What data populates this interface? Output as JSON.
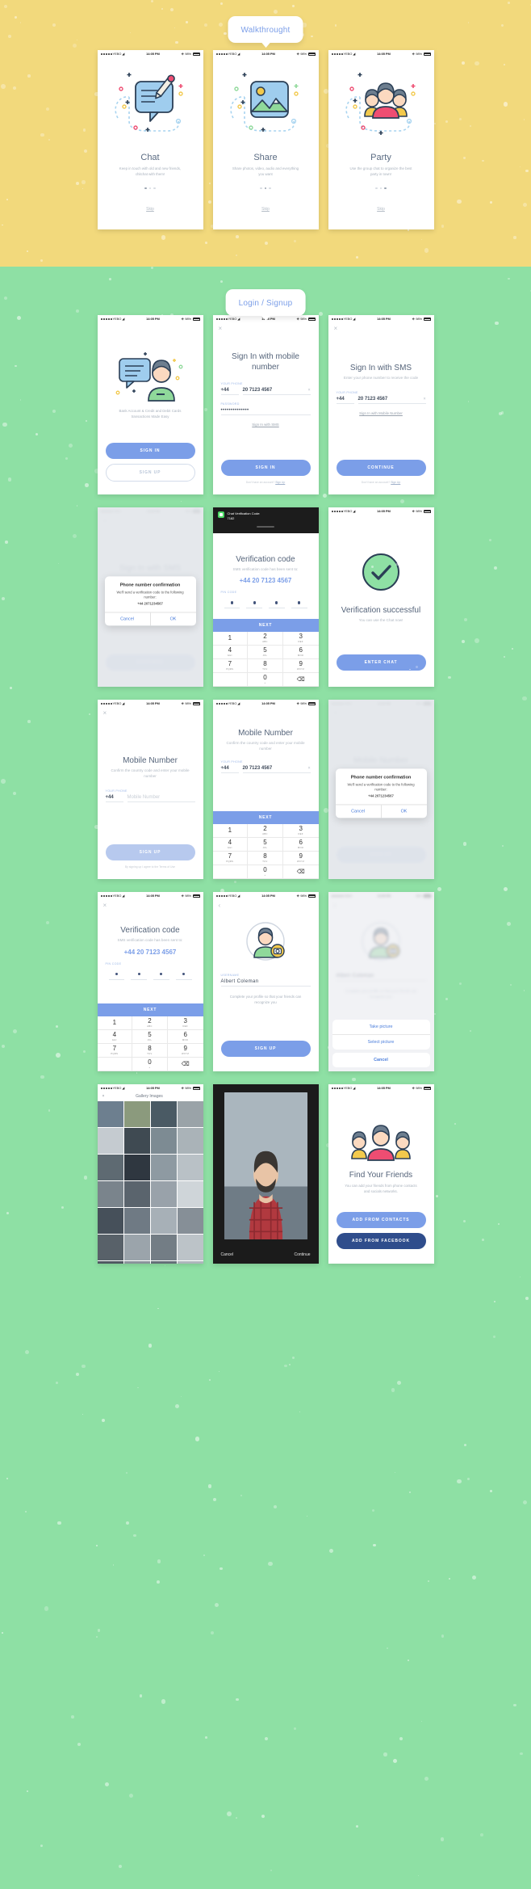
{
  "sections": [
    {
      "id": "walkthrough",
      "label": "Walkthrought",
      "bg": "#f2d97c"
    },
    {
      "id": "login_signup",
      "label": "Login / Signup",
      "bg": "#8ee0a4"
    }
  ],
  "status_bar": {
    "carrier": "YEBO",
    "time": "14:05 PM",
    "battery": "98%",
    "bluetooth_icon": "bluetooth-icon",
    "wifi_icon": "wifi-icon",
    "battery_icon": "battery-icon"
  },
  "walkthrough": {
    "slides": [
      {
        "title": "Chat",
        "subtitle": "Keep in touch with old and new friends, chitchat with them!",
        "skip": "Skip",
        "active_dot": 0,
        "icon": "chat-bubble-pencil-illustration"
      },
      {
        "title": "Share",
        "subtitle": "Share photos, video, audio and everything you want",
        "skip": "Skip",
        "active_dot": 1,
        "icon": "photo-landscape-illustration"
      },
      {
        "title": "Party",
        "subtitle": "Use the group chat to organize the best party in town!",
        "skip": "Skip",
        "active_dot": 2,
        "icon": "group-people-illustration"
      }
    ]
  },
  "screens": {
    "welcome": {
      "tagline": "Bank Account & Credit and Debit Cards transactions Made Easy",
      "sign_in": "SIGN IN",
      "sign_up": "SIGN UP",
      "illustration": "chat-avatar-illustration"
    },
    "sign_in_mobile": {
      "close": "×",
      "title": "Sign In with mobile number",
      "phone_label": "YOUR PHONE",
      "phone_code": "+44",
      "phone_value": "20 7123 4567",
      "clear": "×",
      "password_label": "PASSWORD",
      "password_value": "••••••••••••••",
      "alt_link": "Sign In with SMS",
      "submit": "SIGN IN",
      "legal_prefix": "Don't have an account?",
      "legal_link": "Sign Up"
    },
    "sign_in_sms": {
      "close": "×",
      "title": "Sign In with SMS",
      "subtitle": "Enter your phone number to receive the code",
      "phone_label": "YOUR PHONE",
      "phone_code": "+44",
      "phone_value": "20 7123 4567",
      "clear": "×",
      "alt_link": "Sign In with Mobile Number",
      "submit": "CONTINUE",
      "legal_prefix": "Don't have an account?",
      "legal_link": "Sign Up"
    },
    "sms_confirm_dialog": {
      "bg_title": "Sign In with SMS",
      "bg_subtitle": "Enter your phone number to receive the code",
      "bg_button": "CONTINUE",
      "dialog_title": "Phone number confirmation",
      "dialog_text": "We'll send a verification code to the following number:",
      "dialog_number": "+44 2071234567",
      "cancel": "Cancel",
      "ok": "OK"
    },
    "verification_code": {
      "notification_app": "Chat",
      "notification_title": "Chat Verification Code:",
      "notification_body": "7182",
      "title": "Verification code",
      "subtitle": "SMS verification code has been sent to:",
      "number": "+44 20 7123 4567",
      "pin_label": "PIN CODE",
      "pin_digits": [
        "•",
        "•",
        "•",
        "•"
      ],
      "next": "NEXT"
    },
    "verification_success": {
      "icon": "green-check-circle",
      "title": "Verification successful",
      "subtitle": "You can use the Chat now!",
      "button": "ENTER CHAT"
    },
    "mobile_number_empty": {
      "close": "×",
      "title": "Mobile Number",
      "subtitle": "Confirm the country code and enter your mobile number",
      "phone_label": "YOUR PHONE",
      "phone_code": "+44",
      "placeholder": "Mobile Number",
      "submit": "SIGN UP",
      "legal": "By signing up I agree to the Terms of Use"
    },
    "mobile_number_filled": {
      "title": "Mobile Number",
      "subtitle": "Confirm the country code and enter your mobile number",
      "phone_label": "YOUR PHONE",
      "phone_code": "+44",
      "phone_value": "20 7123 4567",
      "clear": "×",
      "next": "NEXT"
    },
    "mobile_confirm_dialog": {
      "bg_title": "Mobile Number",
      "bg_button": "SIGN UP",
      "dialog_title": "Phone number confirmation",
      "dialog_text": "We'll send a verification code to the following number:",
      "dialog_number": "+44 2071234567",
      "cancel": "Cancel",
      "ok": "OK"
    },
    "signup_verification": {
      "close": "×",
      "title": "Verification code",
      "subtitle": "SMS verification code has been sent to:",
      "number": "+44 20 7123 4567",
      "pin_label": "PIN CODE",
      "next": "NEXT"
    },
    "profile_name": {
      "back": "‹",
      "avatar": "avatar-with-camera-badge",
      "username_label": "USERNAME",
      "username_value": "Albert Coleman",
      "hint": "Complete your profile so that your friends can recognize you",
      "submit": "SIGN UP"
    },
    "photo_action_sheet": {
      "username_value": "Albert Coleman",
      "hint": "Complete your profile so that your friends can recognize you",
      "take_picture": "Take picture",
      "select_picture": "Select picture",
      "cancel": "Cancel"
    },
    "gallery": {
      "close": "×",
      "title": "Gallery Images",
      "tiles": [
        "#6d7f8f",
        "#8b9a7d",
        "#4a5a64",
        "#9aa3a8",
        "#c5cbd0",
        "#3f4a52",
        "#7d8b93",
        "#aab3b8",
        "#5e6a72",
        "#2f3740",
        "#8e9aa2",
        "#b9c1c6",
        "#7a848c",
        "#5a646d",
        "#99a2aa",
        "#cfd5d9",
        "#46505a",
        "#6f7a84",
        "#a7b0b7",
        "#868f97",
        "#586169",
        "#9ba4ab",
        "#737d85",
        "#bcc3c8",
        "#4f5861",
        "#8a939b",
        "#646e77",
        "#adb5bb"
      ]
    },
    "photo_preview": {
      "cancel": "Cancel",
      "continue": "Continue",
      "image": "portrait-photo"
    },
    "find_friends": {
      "illustration": "group-people-illustration",
      "title": "Find Your Friends",
      "subtitle": "You can add your friends from phone contacts and socials networks.",
      "add_contacts": "ADD FROM CONTACTS",
      "add_facebook": "ADD FROM FACEBOOK"
    }
  },
  "keypad": {
    "keys": [
      {
        "digit": "1",
        "letters": ""
      },
      {
        "digit": "2",
        "letters": "ABC"
      },
      {
        "digit": "3",
        "letters": "DEF"
      },
      {
        "digit": "4",
        "letters": "GHI"
      },
      {
        "digit": "5",
        "letters": "JKL"
      },
      {
        "digit": "6",
        "letters": "MNO"
      },
      {
        "digit": "7",
        "letters": "PQRS"
      },
      {
        "digit": "8",
        "letters": "TUV"
      },
      {
        "digit": "9",
        "letters": "WXYZ"
      },
      {
        "digit": "",
        "letters": ""
      },
      {
        "digit": "0",
        "letters": "+"
      },
      {
        "digit": "⌫",
        "letters": ""
      }
    ]
  },
  "colors": {
    "walkthrough_bg": "#f2d97c",
    "login_bg": "#8ee0a4",
    "primary": "#7b9ee8",
    "facebook": "#2f4d8c",
    "success": "#8ee0a4",
    "link": "#4a7ddb"
  }
}
